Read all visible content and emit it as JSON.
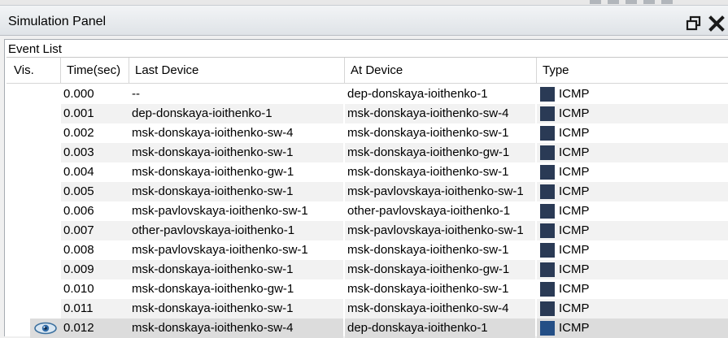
{
  "window": {
    "title": "Simulation Panel"
  },
  "event_list": {
    "title": "Event List",
    "columns": [
      "Vis.",
      "Time(sec)",
      "Last Device",
      "At Device",
      "Type"
    ],
    "rows": [
      {
        "time": "0.000",
        "last": "--",
        "at": "dep-donskaya-ioithenko-1",
        "type": "ICMP",
        "color": "#2a3a55",
        "visible": false
      },
      {
        "time": "0.001",
        "last": "dep-donskaya-ioithenko-1",
        "at": "msk-donskaya-ioithenko-sw-4",
        "type": "ICMP",
        "color": "#2a3a55",
        "visible": false
      },
      {
        "time": "0.002",
        "last": "msk-donskaya-ioithenko-sw-4",
        "at": "msk-donskaya-ioithenko-sw-1",
        "type": "ICMP",
        "color": "#2a3a55",
        "visible": false
      },
      {
        "time": "0.003",
        "last": "msk-donskaya-ioithenko-sw-1",
        "at": "msk-donskaya-ioithenko-gw-1",
        "type": "ICMP",
        "color": "#2a3a55",
        "visible": false
      },
      {
        "time": "0.004",
        "last": "msk-donskaya-ioithenko-gw-1",
        "at": "msk-donskaya-ioithenko-sw-1",
        "type": "ICMP",
        "color": "#2a3a55",
        "visible": false
      },
      {
        "time": "0.005",
        "last": "msk-donskaya-ioithenko-sw-1",
        "at": "msk-pavlovskaya-ioithenko-sw-1",
        "type": "ICMP",
        "color": "#2a3a55",
        "visible": false
      },
      {
        "time": "0.006",
        "last": "msk-pavlovskaya-ioithenko-sw-1",
        "at": "other-pavlovskaya-ioithenko-1",
        "type": "ICMP",
        "color": "#2a3a55",
        "visible": false
      },
      {
        "time": "0.007",
        "last": "other-pavlovskaya-ioithenko-1",
        "at": "msk-pavlovskaya-ioithenko-sw-1",
        "type": "ICMP",
        "color": "#2a3a55",
        "visible": false
      },
      {
        "time": "0.008",
        "last": "msk-pavlovskaya-ioithenko-sw-1",
        "at": "msk-donskaya-ioithenko-sw-1",
        "type": "ICMP",
        "color": "#2a3a55",
        "visible": false
      },
      {
        "time": "0.009",
        "last": "msk-donskaya-ioithenko-sw-1",
        "at": "msk-donskaya-ioithenko-gw-1",
        "type": "ICMP",
        "color": "#2a3a55",
        "visible": false
      },
      {
        "time": "0.010",
        "last": "msk-donskaya-ioithenko-gw-1",
        "at": "msk-donskaya-ioithenko-sw-1",
        "type": "ICMP",
        "color": "#2a3a55",
        "visible": false
      },
      {
        "time": "0.011",
        "last": "msk-donskaya-ioithenko-sw-1",
        "at": "msk-donskaya-ioithenko-sw-4",
        "type": "ICMP",
        "color": "#2a3a55",
        "visible": false
      },
      {
        "time": "0.012",
        "last": "msk-donskaya-ioithenko-sw-4",
        "at": "dep-donskaya-ioithenko-1",
        "type": "ICMP",
        "color": "#244f86",
        "visible": true,
        "selected": true
      }
    ]
  }
}
